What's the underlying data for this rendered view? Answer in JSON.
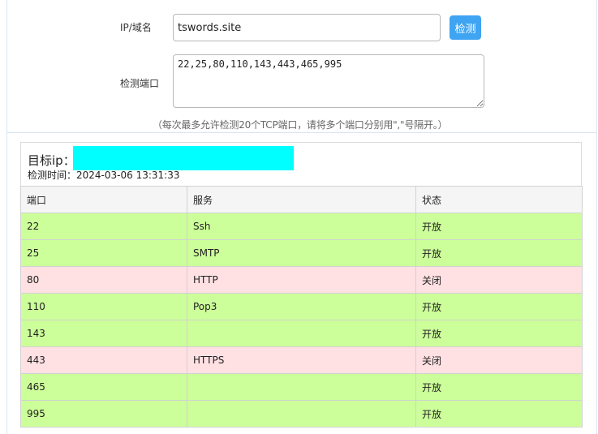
{
  "form": {
    "ip_label": "IP/域名",
    "ip_value": "tswords.site",
    "check_button": "检测",
    "port_label": "检测端口",
    "port_value": "22,25,80,110,143,443,465,995",
    "hint": "（每次最多允许检测20个TCP端口，请将多个端口分别用\",\"号隔开。）"
  },
  "result": {
    "target_label": "目标ip：",
    "time_label": "检测时间：",
    "time_value": "2024-03-06 13:31:33",
    "columns": [
      "端口",
      "服务",
      "状态"
    ],
    "rows": [
      {
        "port": "22",
        "service": "Ssh",
        "status": "开放",
        "state": "open"
      },
      {
        "port": "25",
        "service": "SMTP",
        "status": "开放",
        "state": "open"
      },
      {
        "port": "80",
        "service": "HTTP",
        "status": "关闭",
        "state": "closed"
      },
      {
        "port": "110",
        "service": "Pop3",
        "status": "开放",
        "state": "open"
      },
      {
        "port": "143",
        "service": "",
        "status": "开放",
        "state": "open"
      },
      {
        "port": "443",
        "service": "HTTPS",
        "status": "关闭",
        "state": "closed"
      },
      {
        "port": "465",
        "service": "",
        "status": "开放",
        "state": "open"
      },
      {
        "port": "995",
        "service": "",
        "status": "开放",
        "state": "open"
      }
    ]
  },
  "colors": {
    "open": "#ccff99",
    "closed": "#ffe0e3",
    "button": "#3fa4f2",
    "redaction": "#00ffff"
  }
}
